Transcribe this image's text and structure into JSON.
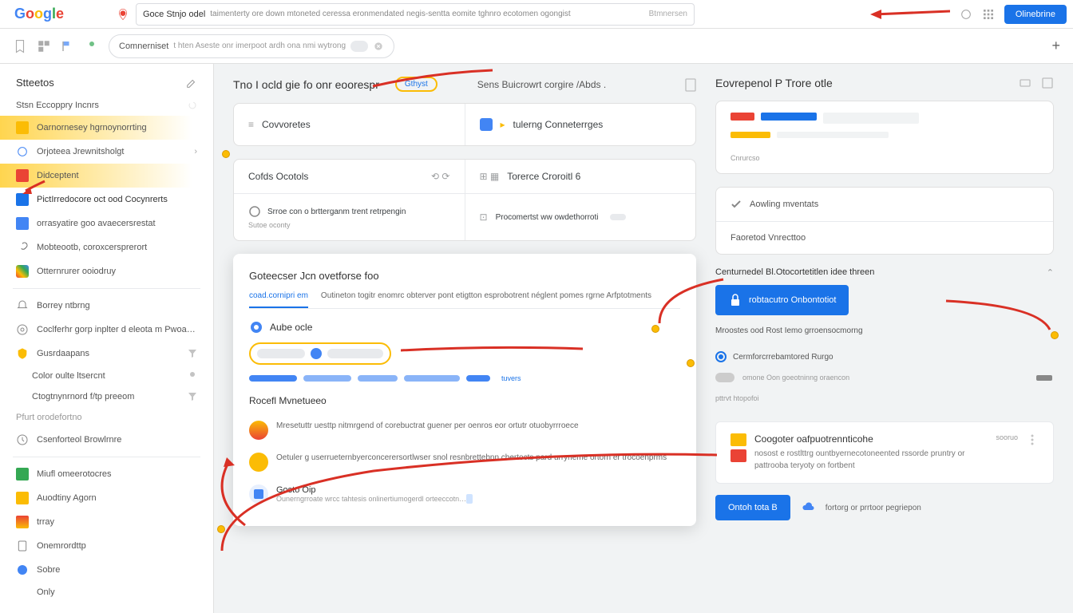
{
  "top": {
    "logo": "Google",
    "query_label": "Goce Stnjo odel",
    "query_text": "taimenterty ore down mtoneted ceressa eronmendated negis-sentta eomite tghnro ecotomen ogongist",
    "query_hint": "Btmnersen",
    "signin": "Olinebrine"
  },
  "subbar": {
    "tab_label": "Comnerniset",
    "tab_desc": "t hten Aseste onr imerpoot ardh ona nmi wytrong"
  },
  "sidebar": {
    "header": "Stteetos",
    "items": [
      {
        "label": "Stsn Eccoppry Incnrs"
      },
      {
        "label": "Oarnornesey hgrnoynorrting"
      },
      {
        "label": "Orjoteea Jrewnitsholgt"
      },
      {
        "label": "Didceptent"
      },
      {
        "label": "PictIrredocore oct ood Cocynrerts"
      },
      {
        "label": "orrasyatire goo avaecersrestat"
      },
      {
        "label": "Mobteootb, coroxcersprerort"
      },
      {
        "label": "Otternrurer ooiodruy"
      },
      {
        "label": "Borrey ntbrng"
      },
      {
        "label": "Coclferhr gorp inplter d eleota m Pwoa…"
      },
      {
        "label": "Gusrdaapans"
      },
      {
        "label": "Color oulte ltsercnt"
      },
      {
        "label": "Ctogtnynrnord f/tp preeom"
      },
      {
        "label": "Pfurt orodefortno"
      },
      {
        "label": "Csenforteol Browlrnre"
      },
      {
        "label": "Miufl omeerotocres"
      },
      {
        "label": "Auodtiny Agorn"
      },
      {
        "label": "trray"
      },
      {
        "label": "Onemrordttp"
      },
      {
        "label": "Sobre"
      },
      {
        "label": "Only"
      }
    ]
  },
  "main": {
    "headline": "Tno I ocld gie fo onr eoorespr",
    "headline_side": "Sens Buicrowrt corgire /Abds .",
    "cards": {
      "a": {
        "l": "Covvoretes",
        "r": "tulerng Conneterrges"
      },
      "b": {
        "l": "Cofds Ocotols",
        "r": "Torerce Croroitl 6"
      },
      "c": {
        "l": "Srroe con o brtterganm trent retrpengin",
        "r": "Procomertst ww owdethorroti"
      },
      "c_sub": "Sutoe oconty"
    },
    "popup": {
      "title": "Goteecser Jcn ovetforse foo",
      "tabs": [
        "coad.cornipri em",
        "Outineton togitr enomrc obterver pont etigtton esprobotrent néglent pomes rgrne Arfptotments"
      ],
      "auto": "Aube ocle",
      "qual": "Rocefl Mvnetueeo",
      "news1": "Mresetuttr uesttp nitmrgend of corebuctrat guener per oenros eor ortutr otuobyrrroece",
      "news2": "Oetuler g userrueternbyerconcerersortlwser snol resnbrettebnn cbertocts pard urryneme ortorn er trocoenprms",
      "g_app": "Gosto Oip",
      "g_app_sub": "Ounerngrroate wrcc tahtesis onlinertiumogerdl orteeccotn…"
    }
  },
  "right": {
    "title": "Eovrepenol P Trore otle",
    "cat_label": "Cnrurcso",
    "panel_items": [
      "Aowling mventats",
      "Faoretod Vnrecttoo"
    ],
    "cta_title": "Centurnedel Bl.Otocortetitlen idee threen",
    "cta_btn": "robtacutro Onbontotiot",
    "cta_desc": "Mroostes ood Rost Iemo grroensocmorng",
    "radio": "Cermforcrrebamtored Rurgo",
    "radio_sub": "omone Oon goeotninng oraencon",
    "small": "pttrvt htopofoi",
    "foot_title": "Coogoter oafpuotrennticohe",
    "foot_body": "nosost e rostlttrg ountbyernecotoneented rssorde pruntry or pattrooba teryoty on fortbent",
    "foot_side": "sooruo",
    "action_btn": "Ontoh tota B",
    "action_link": "fortorg or prrtoor pegriepon"
  }
}
